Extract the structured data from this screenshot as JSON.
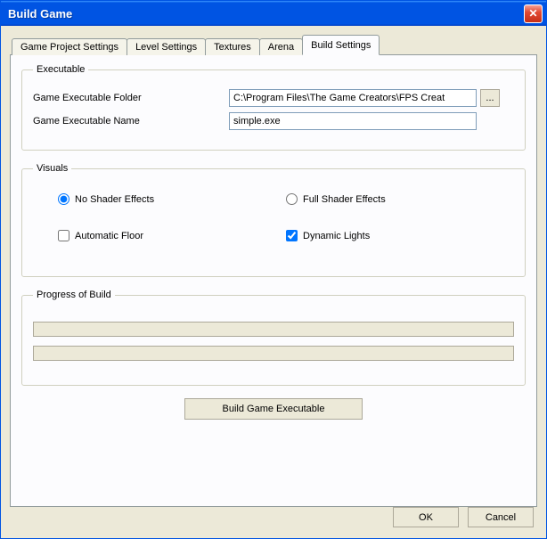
{
  "window": {
    "title": "Build Game",
    "close_label": "✕"
  },
  "tabs": {
    "t0": "Game Project Settings",
    "t1": "Level Settings",
    "t2": "Textures",
    "t3": "Arena",
    "t4": "Build Settings"
  },
  "executable": {
    "legend": "Executable",
    "folder_label": "Game Executable Folder",
    "folder_value": "C:\\Program Files\\The Game Creators\\FPS Creat",
    "browse_label": "...",
    "name_label": "Game Executable Name",
    "name_value": "simple.exe"
  },
  "visuals": {
    "legend": "Visuals",
    "no_shader": "No Shader Effects",
    "full_shader": "Full Shader Effects",
    "auto_floor": "Automatic Floor",
    "dyn_lights": "Dynamic Lights"
  },
  "progress": {
    "legend": "Progress of Build"
  },
  "buttons": {
    "build": "Build Game Executable",
    "ok": "OK",
    "cancel": "Cancel"
  }
}
